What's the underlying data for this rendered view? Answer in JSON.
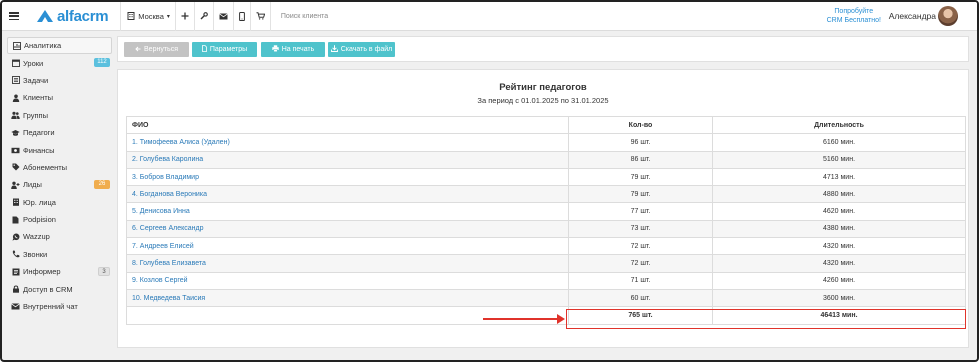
{
  "brand": {
    "logo_text": "alfacrm",
    "color": "#2a8fd4"
  },
  "topbar": {
    "branch": "Москва",
    "icons": [
      "plus-icon",
      "wrench-icon",
      "envelope-icon",
      "mobile-icon",
      "cart-icon"
    ],
    "search_placeholder": "Поиск клиента",
    "try_line1": "Попробуйте",
    "try_line2": "CRM Бесплатно!",
    "user_name": "Александра"
  },
  "sidebar": {
    "items": [
      {
        "label": "Аналитика",
        "icon": "chart-icon",
        "active": true
      },
      {
        "label": "Уроки",
        "icon": "calendar-icon",
        "badge": "112",
        "badge_color": "#5bc0de"
      },
      {
        "label": "Задачи",
        "icon": "tasks-icon"
      },
      {
        "label": "Клиенты",
        "icon": "user-icon"
      },
      {
        "label": "Группы",
        "icon": "users-icon"
      },
      {
        "label": "Педагоги",
        "icon": "graduation-cap-icon"
      },
      {
        "label": "Финансы",
        "icon": "money-icon"
      },
      {
        "label": "Абонементы",
        "icon": "tag-icon"
      },
      {
        "label": "Лиды",
        "icon": "user-plus-icon",
        "badge": "26",
        "badge_color": "#f0ad4e"
      },
      {
        "label": "Юр. лица",
        "icon": "building-icon"
      },
      {
        "label": "Podpision",
        "icon": "file-icon"
      },
      {
        "label": "Wazzup",
        "icon": "whatsapp-icon"
      },
      {
        "label": "Звонки",
        "icon": "phone-icon"
      },
      {
        "label": "Информер",
        "icon": "informer-icon",
        "badge": "3",
        "badge_color": "#d0d0d0"
      },
      {
        "label": "Доступ в CRM",
        "icon": "lock-icon"
      },
      {
        "label": "Внутренний чат",
        "icon": "chat-icon"
      }
    ]
  },
  "toolbar": {
    "back_label": "Вернуться",
    "params_label": "Параметры",
    "print_label": "На печать",
    "download_label": "Скачать в файл"
  },
  "report": {
    "title": "Рейтинг педагогов",
    "period": "За период с 01.01.2025 по 31.01.2025",
    "columns": {
      "name": "ФИО",
      "count": "Кол-во",
      "duration": "Длительность"
    },
    "rows": [
      {
        "name": "1. Тимофеева Алиса (Удален)",
        "count": "96 шт.",
        "duration": "6160 мин."
      },
      {
        "name": "2. Голубева Каролина",
        "count": "86 шт.",
        "duration": "5160 мин."
      },
      {
        "name": "3. Бобров Владимир",
        "count": "79 шт.",
        "duration": "4713 мин."
      },
      {
        "name": "4. Богданова Вероника",
        "count": "79 шт.",
        "duration": "4880 мин."
      },
      {
        "name": "5. Денисова Инна",
        "count": "77 шт.",
        "duration": "4620 мин."
      },
      {
        "name": "6. Сергеев Александр",
        "count": "73 шт.",
        "duration": "4380 мин."
      },
      {
        "name": "7. Андреев Елисей",
        "count": "72 шт.",
        "duration": "4320 мин."
      },
      {
        "name": "8. Голубева Елизавета",
        "count": "72 шт.",
        "duration": "4320 мин."
      },
      {
        "name": "9. Козлов Сергей",
        "count": "71 шт.",
        "duration": "4260 мин."
      },
      {
        "name": "10. Медведева Таисия",
        "count": "60 шт.",
        "duration": "3600 мин."
      }
    ],
    "total": {
      "name": "",
      "count": "765 шт.",
      "duration": "46413 мин."
    }
  }
}
